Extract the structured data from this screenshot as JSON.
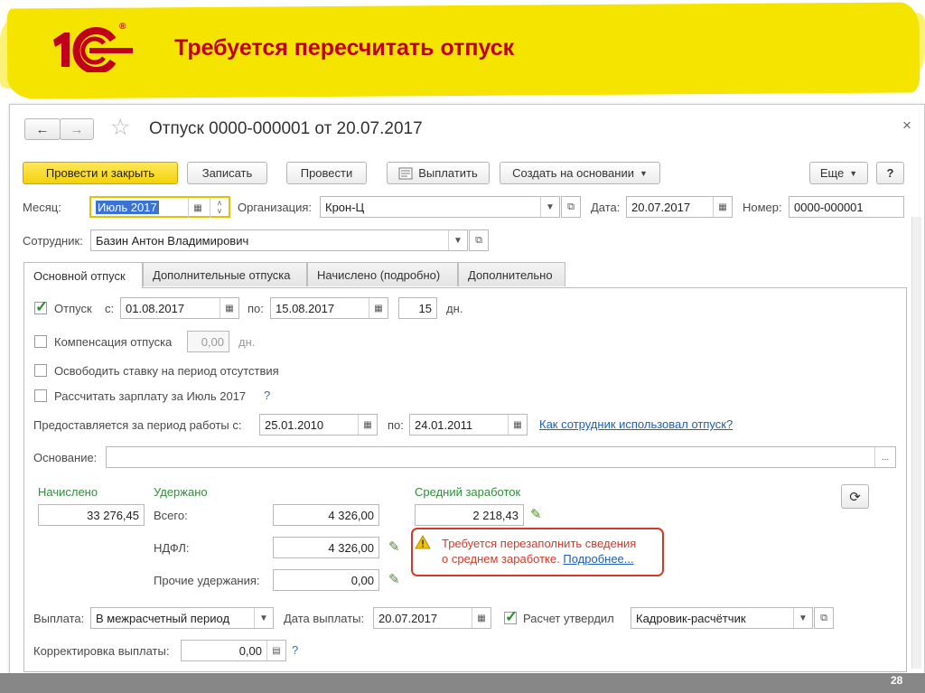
{
  "slide": {
    "title": "Требуется пересчитать отпуск",
    "logo_text": "1С",
    "logo_sup": "®",
    "page_number": "28",
    "accent_color": "#c0001a",
    "banner_color": "#f5e400"
  },
  "window": {
    "back_icon": "←",
    "forward_icon": "→",
    "star_icon": "☆",
    "title": "Отпуск 0000-000001 от 20.07.2017",
    "close_icon": "×"
  },
  "toolbar": {
    "post_close": "Провести и закрыть",
    "save": "Записать",
    "post": "Провести",
    "pay": "Выплатить",
    "create_based": "Создать на основании",
    "more": "Еще",
    "help": "?"
  },
  "header": {
    "month_label": "Месяц:",
    "month_value": "Июль 2017",
    "org_label": "Организация:",
    "org_value": "Крон-Ц",
    "date_label": "Дата:",
    "date_value": "20.07.2017",
    "number_label": "Номер:",
    "number_value": "0000-000001",
    "employee_label": "Сотрудник:",
    "employee_value": "Базин Антон Владимирович"
  },
  "tabs": [
    {
      "label": "Основной отпуск"
    },
    {
      "label": "Дополнительные отпуска"
    },
    {
      "label": "Начислено (подробно)"
    },
    {
      "label": "Дополнительно"
    }
  ],
  "main": {
    "vacation_label": "Отпуск",
    "from_label": "с:",
    "from_value": "01.08.2017",
    "to_label": "по:",
    "to_value": "15.08.2017",
    "days_value": "15",
    "days_label": "дн.",
    "compensation_label": "Компенсация отпуска",
    "compensation_value": "0,00",
    "compensation_unit": "дн.",
    "free_rate_label": "Освободить ставку на период отсутствия",
    "calc_salary_label": "Рассчитать зарплату за Июль 2017",
    "calc_salary_help": "?",
    "period_label": "Предоставляется за период работы с:",
    "period_from": "25.01.2010",
    "period_to_label": "по:",
    "period_to": "24.01.2011",
    "usage_link": "Как сотрудник использовал отпуск?",
    "basis_label": "Основание:",
    "basis_value": "",
    "basis_btn": "..."
  },
  "totals": {
    "accrued_label": "Начислено",
    "accrued_value": "33 276,45",
    "withheld_label": "Удержано",
    "total_label": "Всего:",
    "total_value": "4 326,00",
    "ndfl_label": "НДФЛ:",
    "ndfl_value": "4 326,00",
    "other_label": "Прочие удержания:",
    "other_value": "0,00",
    "avg_label": "Средний заработок",
    "avg_value": "2 218,43",
    "warning_line1": "Требуется перезаполнить сведения",
    "warning_line2": "о среднем заработке.",
    "warning_link": "Подробнее...",
    "warning_color": "#d03a2a"
  },
  "payment": {
    "label": "Выплата:",
    "value": "В межрасчетный период",
    "date_label": "Дата выплаты:",
    "date_value": "20.07.2017",
    "approved_label": "Расчет утвердил",
    "approved_value": "Кадровик-расчётчик",
    "adjust_label": "Корректировка выплаты:",
    "adjust_value": "0,00",
    "adjust_help": "?"
  }
}
